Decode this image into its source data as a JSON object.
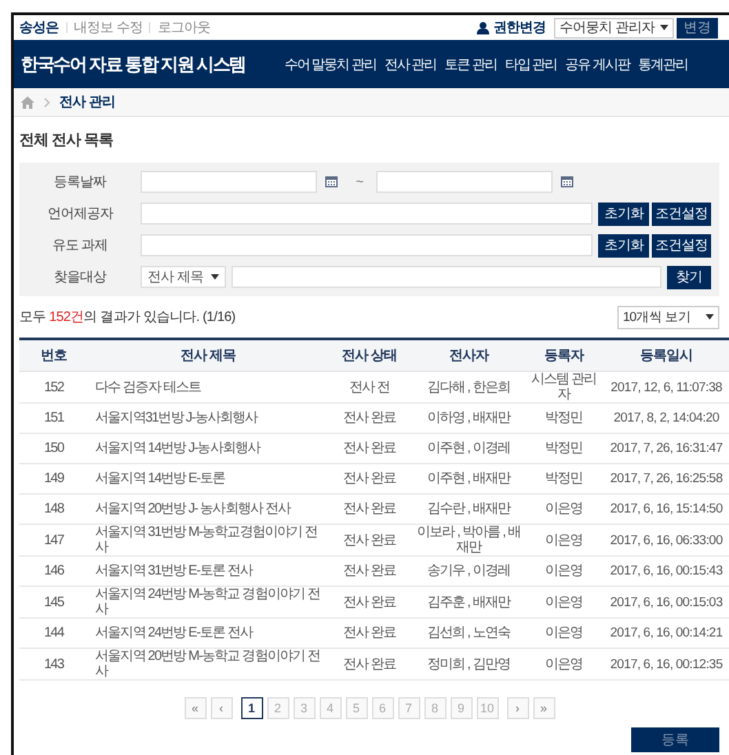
{
  "top_bar": {
    "user_links": [
      {
        "label": "송성은",
        "kind": "user"
      },
      {
        "label": "내정보 수정",
        "kind": "link"
      },
      {
        "label": "로그아웃",
        "kind": "link"
      }
    ],
    "role_label": "권한변경",
    "role_select": "수어뭉치 관리자",
    "role_button": "변경"
  },
  "header": {
    "title": "한국수어 자료 통합 지원 시스템",
    "nav": [
      {
        "label": "수어 말뭉치 관리",
        "selected": false
      },
      {
        "label": "전사 관리",
        "selected": false
      },
      {
        "label": "토큰 관리",
        "selected": false
      },
      {
        "label": "타입 관리",
        "selected": false
      },
      {
        "label": "공유 게시판",
        "selected": false
      },
      {
        "label": "통계관리",
        "selected": false
      }
    ]
  },
  "breadcrumb": [
    "전사 관리"
  ],
  "page_title": "전체 전사 목록",
  "filters": [
    {
      "kind": "date_range",
      "label": "등록날짜",
      "separator": "~"
    },
    {
      "kind": "text_buttons",
      "label": "언어제공자",
      "buttons": [
        "초기화",
        "조건설정"
      ]
    },
    {
      "kind": "text_buttons",
      "label": "유도 과제",
      "buttons": [
        "초기화",
        "조건설정"
      ]
    },
    {
      "kind": "search",
      "label": "찾을대상",
      "select": "전사 제목",
      "button": "찾기"
    }
  ],
  "results": {
    "prefix": "모두 ",
    "count": "152건",
    "suffix": "의 결과가 있습니다. (1/16)",
    "page_size": "10개씩 보기"
  },
  "table": {
    "columns": [
      "번호",
      "전사 제목",
      "전사 상태",
      "전사자",
      "등록자",
      "등록일시"
    ],
    "rows": [
      [
        "152",
        "다수 검증자 테스트",
        "전사 전",
        "김다해 , 한은희",
        "시스템 관리자",
        "2017, 12, 6, 11:07:38"
      ],
      [
        "151",
        "서울지역31번방 J-농사회행사",
        "전사 완료",
        "이하영 , 배재만",
        "박정민",
        "2017, 8, 2, 14:04:20"
      ],
      [
        "150",
        "서울지역 14번방 J-농사회행사",
        "전사 완료",
        "이주현 , 이경레",
        "박정민",
        "2017, 7, 26, 16:31:47"
      ],
      [
        "149",
        "서울지역 14번방 E-토론",
        "전사 완료",
        "이주현 , 배재만",
        "박정민",
        "2017, 7, 26, 16:25:58"
      ],
      [
        "148",
        "서울지역 20번방 J- 농사회행사 전사",
        "전사 완료",
        "김수란 , 배재만",
        "이은영",
        "2017, 6, 16, 15:14:50"
      ],
      [
        "147",
        "서울지역 31번방 M-농학교경험이야기 전사",
        "전사 완료",
        "이보라 , 박아름 , 배재만",
        "이은영",
        "2017, 6, 16, 06:33:00"
      ],
      [
        "146",
        "서울지역 31번방 E-토론 전사",
        "전사 완료",
        "송기우 , 이경레",
        "이은영",
        "2017, 6, 16, 00:15:43"
      ],
      [
        "145",
        "서울지역 24번방 M-농학교 경험이야기 전사",
        "전사 완료",
        "김주훈 , 배재만",
        "이은영",
        "2017, 6, 16, 00:15:03"
      ],
      [
        "144",
        "서울지역 24번방 E-토론 전사",
        "전사 완료",
        "김선희 , 노연숙",
        "이은영",
        "2017, 6, 16, 00:14:21"
      ],
      [
        "143",
        "서울지역 20번방 M-농학교 경험이야기 전사",
        "전사 완료",
        "정미희 , 김만영",
        "이은영",
        "2017, 6, 16, 00:12:35"
      ]
    ]
  },
  "pagination": [
    {
      "label": "«",
      "kind": "nav"
    },
    {
      "label": "‹",
      "kind": "nav"
    },
    {
      "label": "1",
      "kind": "page",
      "selected": true
    },
    {
      "label": "2",
      "kind": "page",
      "selected": false
    },
    {
      "label": "3",
      "kind": "page",
      "selected": false
    },
    {
      "label": "4",
      "kind": "page",
      "selected": false
    },
    {
      "label": "5",
      "kind": "page",
      "selected": false
    },
    {
      "label": "6",
      "kind": "page",
      "selected": false
    },
    {
      "label": "7",
      "kind": "page",
      "selected": false
    },
    {
      "label": "8",
      "kind": "page",
      "selected": false
    },
    {
      "label": "9",
      "kind": "page",
      "selected": false
    },
    {
      "label": "10",
      "kind": "page",
      "selected": false
    },
    {
      "label": "›",
      "kind": "nav"
    },
    {
      "label": "»",
      "kind": "nav"
    }
  ],
  "register_button": "등록"
}
